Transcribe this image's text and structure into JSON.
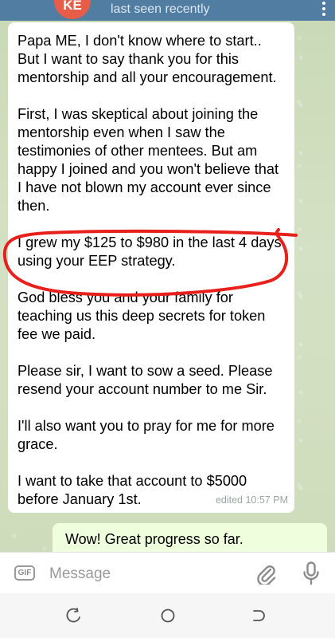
{
  "header": {
    "avatar_initials": "KE",
    "status": "last seen recently"
  },
  "incoming_message": {
    "paragraphs": [
      "Papa ME, I don't know where to start.. But I want to say thank you for this mentorship and all your encouragement.",
      "First, I was skeptical about joining the mentorship even when I saw the testimonies of other mentees. But am happy I joined and you won't believe that I have not blown my account ever since then.",
      "I grew my $125 to $980 in the last 4 days using your EEP strategy.",
      "God bless you and your family for teaching us this deep secrets for token fee we paid.",
      "Please sir, I want to sow a seed. Please resend your account number to me Sir.",
      "I'll also want you to pray for me for more grace.",
      "I want to take that account to $5000 before January 1st."
    ],
    "timestamp": "edited 10:57 PM"
  },
  "outgoing_message": {
    "text": "Wow! Great progress so far."
  },
  "composer": {
    "gif_label": "GIF",
    "placeholder": "Message"
  },
  "icons": {
    "menu": "more-vert-icon",
    "attach": "paperclip-icon",
    "mic": "microphone-icon",
    "nav_recents": "recents-icon",
    "nav_home": "home-icon",
    "nav_back": "back-icon"
  },
  "colors": {
    "header": "#517da2",
    "annotation": "#e8201c",
    "outgoing_bubble": "#effedd",
    "avatar": "#e85d48"
  }
}
